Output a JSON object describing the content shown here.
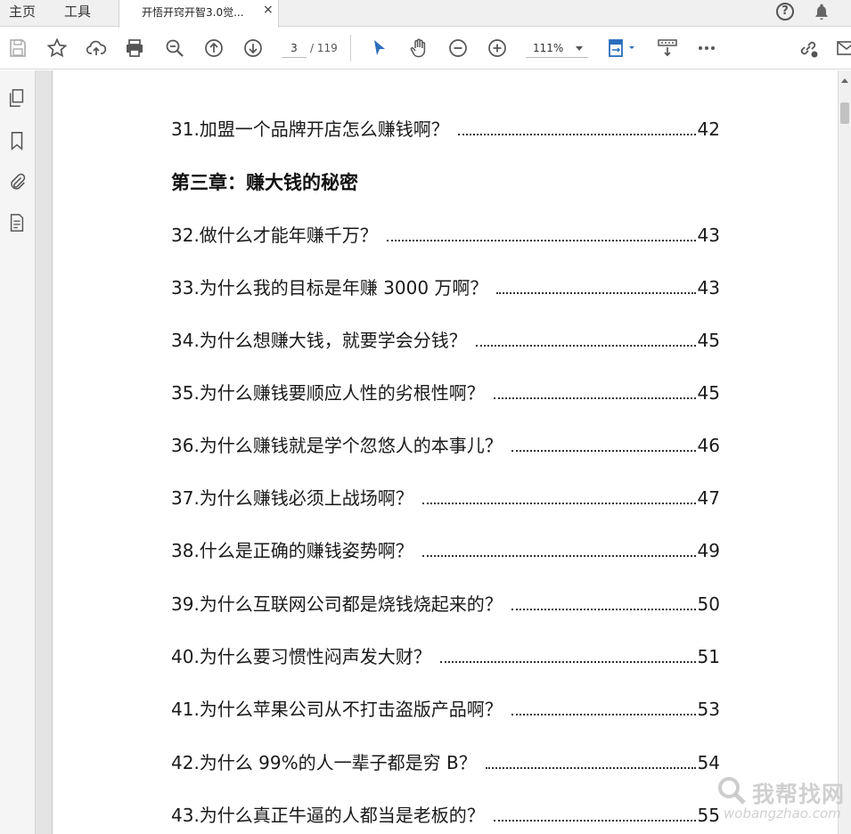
{
  "tabbar": {
    "home_label": "主页",
    "tools_label": "工具",
    "doc_tab_title": "开悟开窍开智3.0觉...",
    "close_glyph": "×",
    "help_glyph": "?"
  },
  "toolbar": {
    "current_page": "3",
    "page_total": "/ 119",
    "zoom": "111%"
  },
  "document": {
    "chapter_title": "第三章：赚大钱的秘密",
    "entries": [
      {
        "title": "31.加盟一个品牌开店怎么赚钱啊？",
        "page": "42"
      },
      {
        "title": "32.做什么才能年赚千万？",
        "page": "43"
      },
      {
        "title": "33.为什么我的目标是年赚 3000 万啊？",
        "page": "43"
      },
      {
        "title": "34.为什么想赚大钱，就要学会分钱？",
        "page": "45"
      },
      {
        "title": "35.为什么赚钱要顺应人性的劣根性啊？",
        "page": "45"
      },
      {
        "title": "36.为什么赚钱就是学个忽悠人的本事儿？",
        "page": "46"
      },
      {
        "title": "37.为什么赚钱必须上战场啊？",
        "page": "47"
      },
      {
        "title": "38.什么是正确的赚钱姿势啊？",
        "page": "49"
      },
      {
        "title": "39.为什么互联网公司都是烧钱烧起来的？",
        "page": "50"
      },
      {
        "title": "40.为什么要习惯性闷声发大财？",
        "page": "51"
      },
      {
        "title": "41.为什么苹果公司从不打击盗版产品啊？",
        "page": "53"
      },
      {
        "title": "42.为什么 99%的人一辈子都是穷 B？",
        "page": "54"
      },
      {
        "title": "43.为什么真正牛逼的人都当是老板的？",
        "page": "55"
      }
    ]
  },
  "watermark": {
    "title": "我帮找网",
    "url": "wobangzhao.com"
  },
  "colors": {
    "accent_blue": "#2a6ebb",
    "icon_gray": "#555555"
  }
}
